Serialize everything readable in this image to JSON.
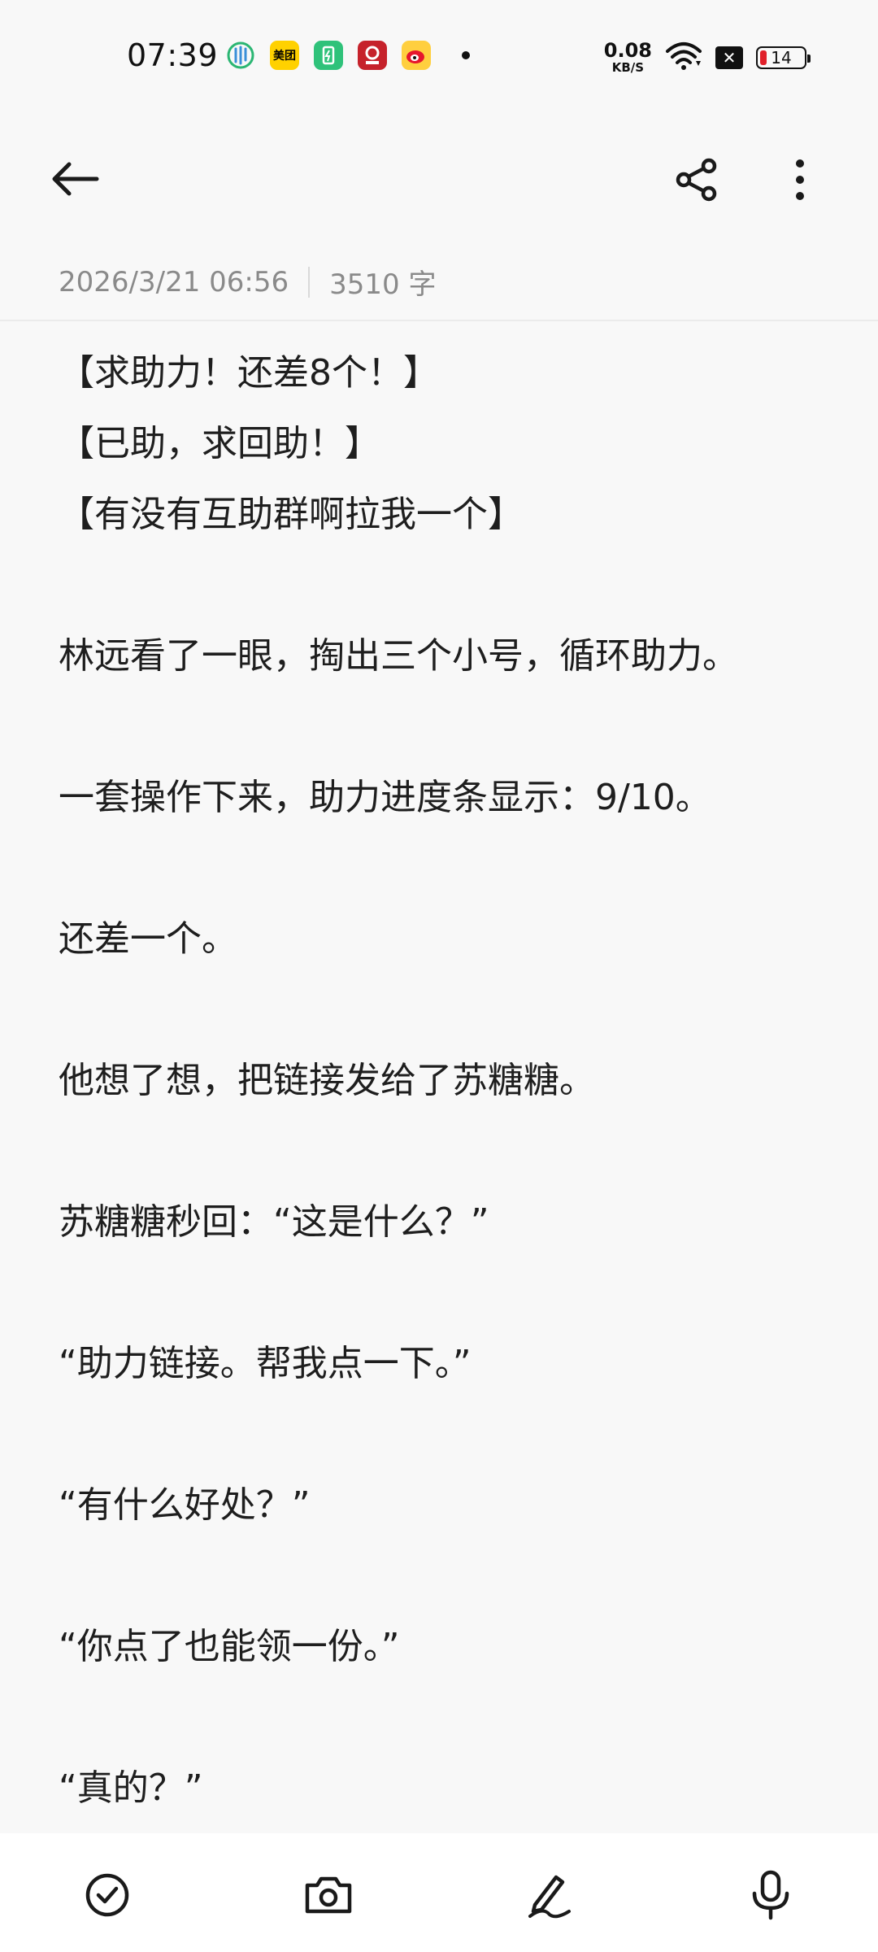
{
  "status_bar": {
    "time": "07:39",
    "app_icons": [
      {
        "name": "leaf-app-icon",
        "label": ""
      },
      {
        "name": "meituan-app-icon",
        "label": "美团"
      },
      {
        "name": "battery-app-icon",
        "label": ""
      },
      {
        "name": "red-app-icon",
        "label": ""
      },
      {
        "name": "weibo-app-icon",
        "label": ""
      }
    ],
    "net_speed_value": "0.08",
    "net_speed_unit": "KB/S",
    "battery_level": "14"
  },
  "note": {
    "date": "2026/3/21 06:56",
    "word_count": "3510 字",
    "lines": [
      "【求助力！还差8个！】",
      "【已助，求回助！】",
      "【有没有互助群啊拉我一个】",
      "",
      "林远看了一眼，掏出三个小号，循环助力。",
      "",
      "一套操作下来，助力进度条显示：9/10。",
      "",
      "还差一个。",
      "",
      "他想了想，把链接发给了苏糖糖。",
      "",
      "苏糖糖秒回：“这是什么？”",
      "",
      "“助力链接。帮我点一下。”",
      "",
      "“有什么好处？”",
      "",
      "“你点了也能领一份。”",
      "",
      "“真的？”"
    ]
  },
  "colors": {
    "background": "#f8f8f8",
    "text": "#1e1e1e",
    "meta_text": "#8a8a8a",
    "battery_low": "#e0202a"
  }
}
